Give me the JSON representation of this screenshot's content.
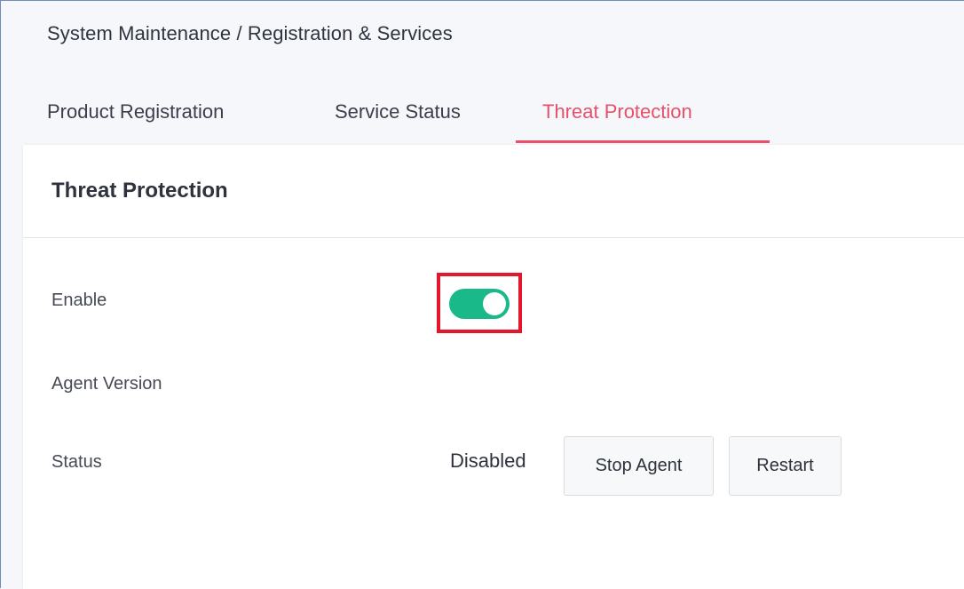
{
  "breadcrumb": "System Maintenance / Registration & Services",
  "tabs": [
    {
      "label": "Product Registration",
      "active": false
    },
    {
      "label": "Service Status",
      "active": false
    },
    {
      "label": "Threat Protection",
      "active": true
    }
  ],
  "card": {
    "title": "Threat Protection",
    "rows": {
      "enable_label": "Enable",
      "enable_value": true,
      "agent_version_label": "Agent Version",
      "agent_version_value": "",
      "status_label": "Status",
      "status_value": "Disabled"
    },
    "buttons": {
      "stop_agent": "Stop Agent",
      "restart": "Restart"
    }
  },
  "colors": {
    "accent_tab": "#e8506a",
    "toggle_on": "#19b98a",
    "highlight_box": "#e3162d"
  },
  "icons": {
    "toggle": "toggle-switch-icon"
  }
}
